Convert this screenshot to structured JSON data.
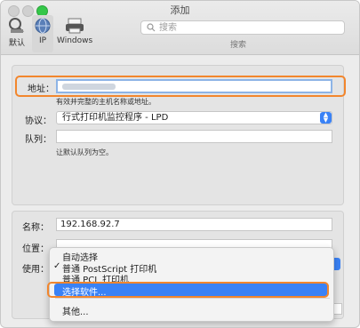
{
  "window": {
    "title": "添加"
  },
  "toolbar": {
    "items": [
      {
        "label": "默认",
        "icon": "default-printer-icon"
      },
      {
        "label": "IP",
        "icon": "globe-icon"
      },
      {
        "label": "Windows",
        "icon": "windows-printer-icon"
      }
    ],
    "search": {
      "placeholder": "搜索",
      "label": "搜索"
    }
  },
  "form": {
    "address": {
      "label": "地址：",
      "hint": "有效并完整的主机名称或地址。"
    },
    "protocol": {
      "label": "协议：",
      "value": "行式打印机监控程序 - LPD"
    },
    "queue": {
      "label": "队列：",
      "value": "",
      "hint": "让默认队列为空。"
    },
    "name": {
      "label": "名称：",
      "value": "192.168.92.7"
    },
    "location": {
      "label": "位置："
    },
    "use": {
      "label": "使用："
    }
  },
  "menu": {
    "items": [
      {
        "label": "自动选择",
        "checked": false
      },
      {
        "label": "普通 PostScript 打印机",
        "checked": true
      },
      {
        "label": "普通 PCL 打印机",
        "checked": false
      },
      {
        "label": "选择软件...",
        "selected": true
      },
      {
        "label": "其他...",
        "checked": false
      }
    ],
    "check_glyph": "✓"
  },
  "colors": {
    "accent": "#3a82f6",
    "highlight_ring": "#f2862d"
  }
}
